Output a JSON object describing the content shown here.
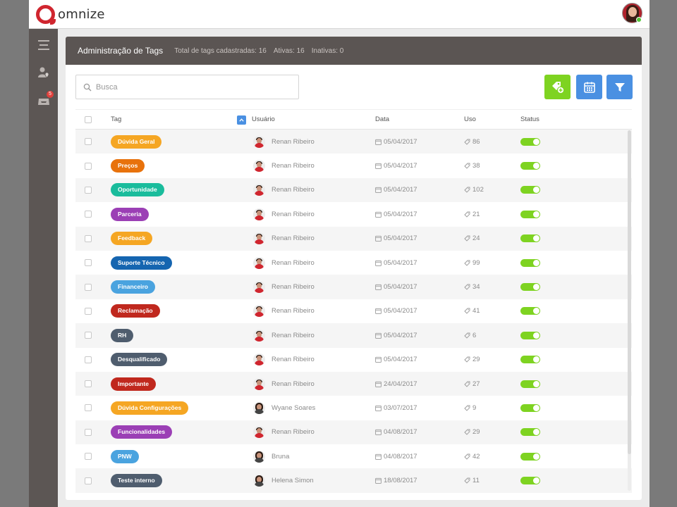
{
  "app": {
    "logo_text": "omnize"
  },
  "sidebar": {
    "notifications_count": "5"
  },
  "header": {
    "title": "Administração de Tags",
    "total": "Total de tags cadastradas: 16",
    "active": "Ativas: 16",
    "inactive": "Inativas: 0"
  },
  "search": {
    "placeholder": "Busca"
  },
  "columns": {
    "tag": "Tag",
    "user": "Usuário",
    "date": "Data",
    "uso": "Uso",
    "status": "Status"
  },
  "colors": {
    "accent_green": "#7ed321",
    "accent_blue": "#4a90e2",
    "brand_red": "#d0262f"
  },
  "rows": [
    {
      "tag": "Dúvida Geral",
      "color": "#f5a623",
      "user": "Renan Ribeiro",
      "avatar": "male",
      "date": "05/04/2017",
      "uso": "86",
      "status": true
    },
    {
      "tag": "Preços",
      "color": "#e8720c",
      "user": "Renan Ribeiro",
      "avatar": "male",
      "date": "05/04/2017",
      "uso": "38",
      "status": true
    },
    {
      "tag": "Oportunidade",
      "color": "#1abc9c",
      "user": "Renan Ribeiro",
      "avatar": "male",
      "date": "05/04/2017",
      "uso": "102",
      "status": true
    },
    {
      "tag": "Parceria",
      "color": "#9b3fb5",
      "user": "Renan Ribeiro",
      "avatar": "male",
      "date": "05/04/2017",
      "uso": "21",
      "status": true
    },
    {
      "tag": "Feedback",
      "color": "#f5a623",
      "user": "Renan Ribeiro",
      "avatar": "male",
      "date": "05/04/2017",
      "uso": "24",
      "status": true
    },
    {
      "tag": "Suporte Técnico",
      "color": "#1565b0",
      "user": "Renan Ribeiro",
      "avatar": "male",
      "date": "05/04/2017",
      "uso": "99",
      "status": true
    },
    {
      "tag": "Financeiro",
      "color": "#4aa3df",
      "user": "Renan Ribeiro",
      "avatar": "male",
      "date": "05/04/2017",
      "uso": "34",
      "status": true
    },
    {
      "tag": "Reclamação",
      "color": "#c0281e",
      "user": "Renan Ribeiro",
      "avatar": "male",
      "date": "05/04/2017",
      "uso": "41",
      "status": true
    },
    {
      "tag": "RH",
      "color": "#4f5d6e",
      "user": "Renan Ribeiro",
      "avatar": "male",
      "date": "05/04/2017",
      "uso": "6",
      "status": true
    },
    {
      "tag": "Desqualificado",
      "color": "#4f5d6e",
      "user": "Renan Ribeiro",
      "avatar": "male",
      "date": "05/04/2017",
      "uso": "29",
      "status": true
    },
    {
      "tag": "Importante",
      "color": "#c0281e",
      "user": "Renan Ribeiro",
      "avatar": "male",
      "date": "24/04/2017",
      "uso": "27",
      "status": true
    },
    {
      "tag": "Dúvida Configurações",
      "color": "#f5a623",
      "user": "Wyane Soares",
      "avatar": "woman",
      "date": "03/07/2017",
      "uso": "9",
      "status": true
    },
    {
      "tag": "Funcionalidades",
      "color": "#9b3fb5",
      "user": "Renan Ribeiro",
      "avatar": "male",
      "date": "04/08/2017",
      "uso": "29",
      "status": true
    },
    {
      "tag": "PNW",
      "color": "#4aa3df",
      "user": "Bruna",
      "avatar": "woman",
      "date": "04/08/2017",
      "uso": "42",
      "status": true
    },
    {
      "tag": "Teste interno",
      "color": "#4f5d6e",
      "user": "Helena Simon",
      "avatar": "woman",
      "date": "18/08/2017",
      "uso": "11",
      "status": true
    }
  ]
}
